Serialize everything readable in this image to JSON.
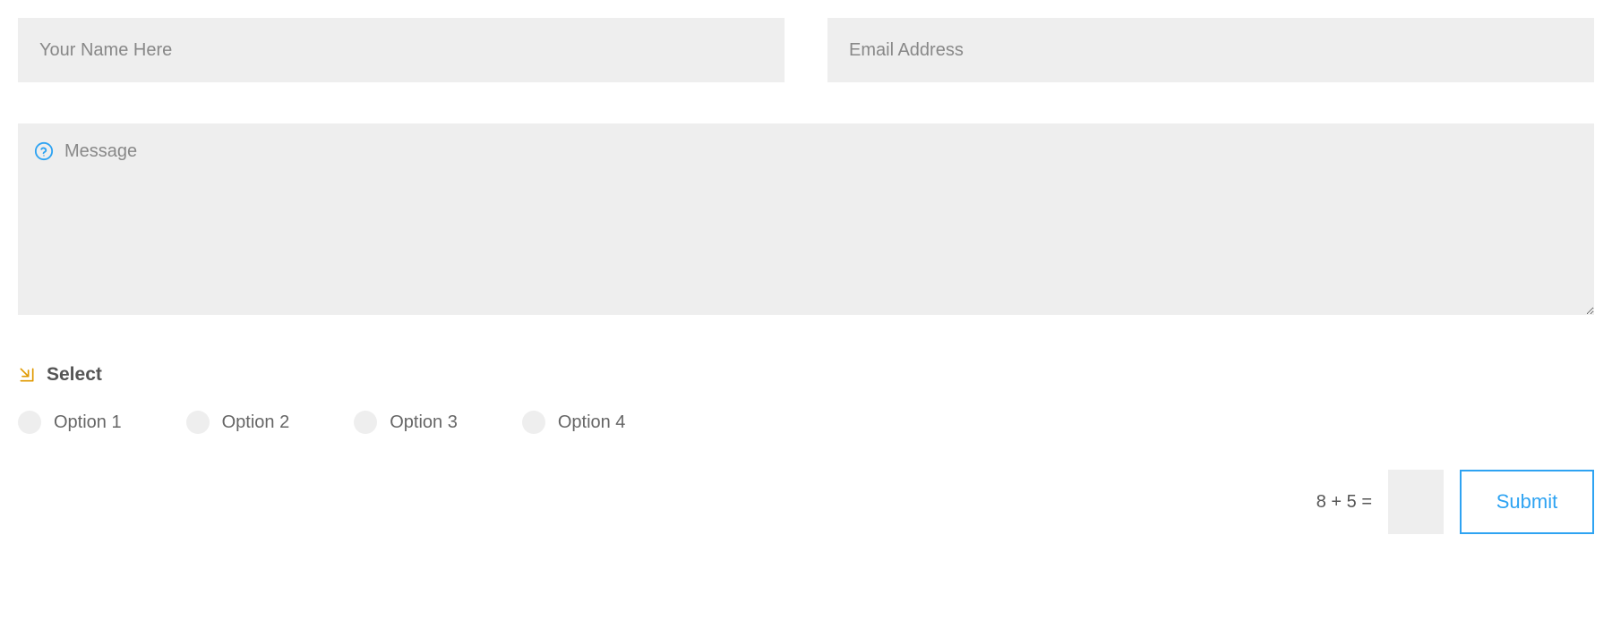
{
  "form": {
    "name": {
      "placeholder": "Your Name Here",
      "value": ""
    },
    "email": {
      "placeholder": "Email Address",
      "value": ""
    },
    "message": {
      "placeholder": "Message",
      "value": ""
    },
    "select": {
      "label": "Select",
      "options": [
        {
          "label": "Option 1"
        },
        {
          "label": "Option 2"
        },
        {
          "label": "Option 3"
        },
        {
          "label": "Option 4"
        }
      ]
    },
    "captcha": {
      "question": "8 + 5 =",
      "value": ""
    },
    "submit": {
      "label": "Submit"
    }
  },
  "colors": {
    "accent": "#2ea3f2",
    "fieldBg": "#eeeeee",
    "iconOrange": "#e09900",
    "iconBlue": "#2ea3f2"
  }
}
